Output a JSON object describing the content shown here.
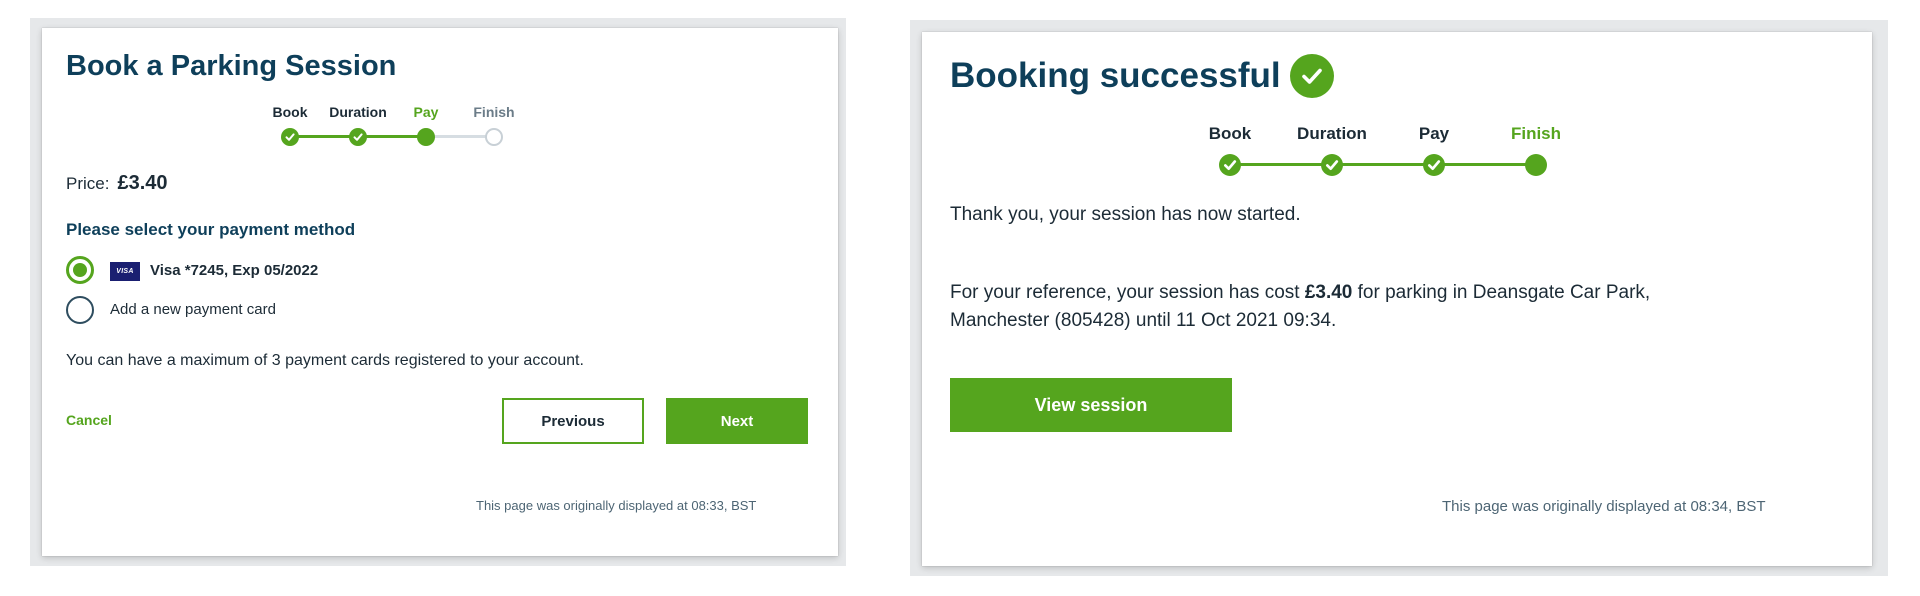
{
  "colors": {
    "accent_green": "#55a51e",
    "title_navy": "#0e3f5a",
    "text": "#1c2b36",
    "visa_blue": "#1a1f71"
  },
  "left": {
    "title": "Book a Parking Session",
    "stepper": {
      "steps": [
        {
          "label": "Book",
          "state": "done"
        },
        {
          "label": "Duration",
          "state": "done"
        },
        {
          "label": "Pay",
          "state": "active"
        },
        {
          "label": "Finish",
          "state": "pending"
        }
      ]
    },
    "price_label": "Price:",
    "price_value": "£3.40",
    "payment_heading": "Please select your payment method",
    "payment_options": [
      {
        "label": "Visa *7245, Exp 05/2022",
        "selected": true,
        "icon": "visa-card-icon"
      },
      {
        "label": "Add a new payment card",
        "selected": false
      }
    ],
    "visa_logo_text": "VISA",
    "max_cards_text": "You can have a maximum of 3 payment cards registered to your account.",
    "cancel_label": "Cancel",
    "previous_label": "Previous",
    "next_label": "Next",
    "footer": "This page was originally displayed at 08:33, BST"
  },
  "right": {
    "title": "Booking successful",
    "title_icon": "check-circle-icon",
    "stepper": {
      "steps": [
        {
          "label": "Book",
          "state": "done"
        },
        {
          "label": "Duration",
          "state": "done"
        },
        {
          "label": "Pay",
          "state": "done"
        },
        {
          "label": "Finish",
          "state": "active"
        }
      ]
    },
    "thank_you": "Thank you, your session has now started.",
    "reference_prefix": "For your reference, your session has cost",
    "reference_amount": "£3.40",
    "reference_suffix": "for parking in Deansgate Car Park,",
    "reference_line2": "Manchester (805428) until 11 Oct 2021 09:34.",
    "view_session_label": "View session",
    "footer": "This page was originally displayed at 08:34, BST"
  }
}
